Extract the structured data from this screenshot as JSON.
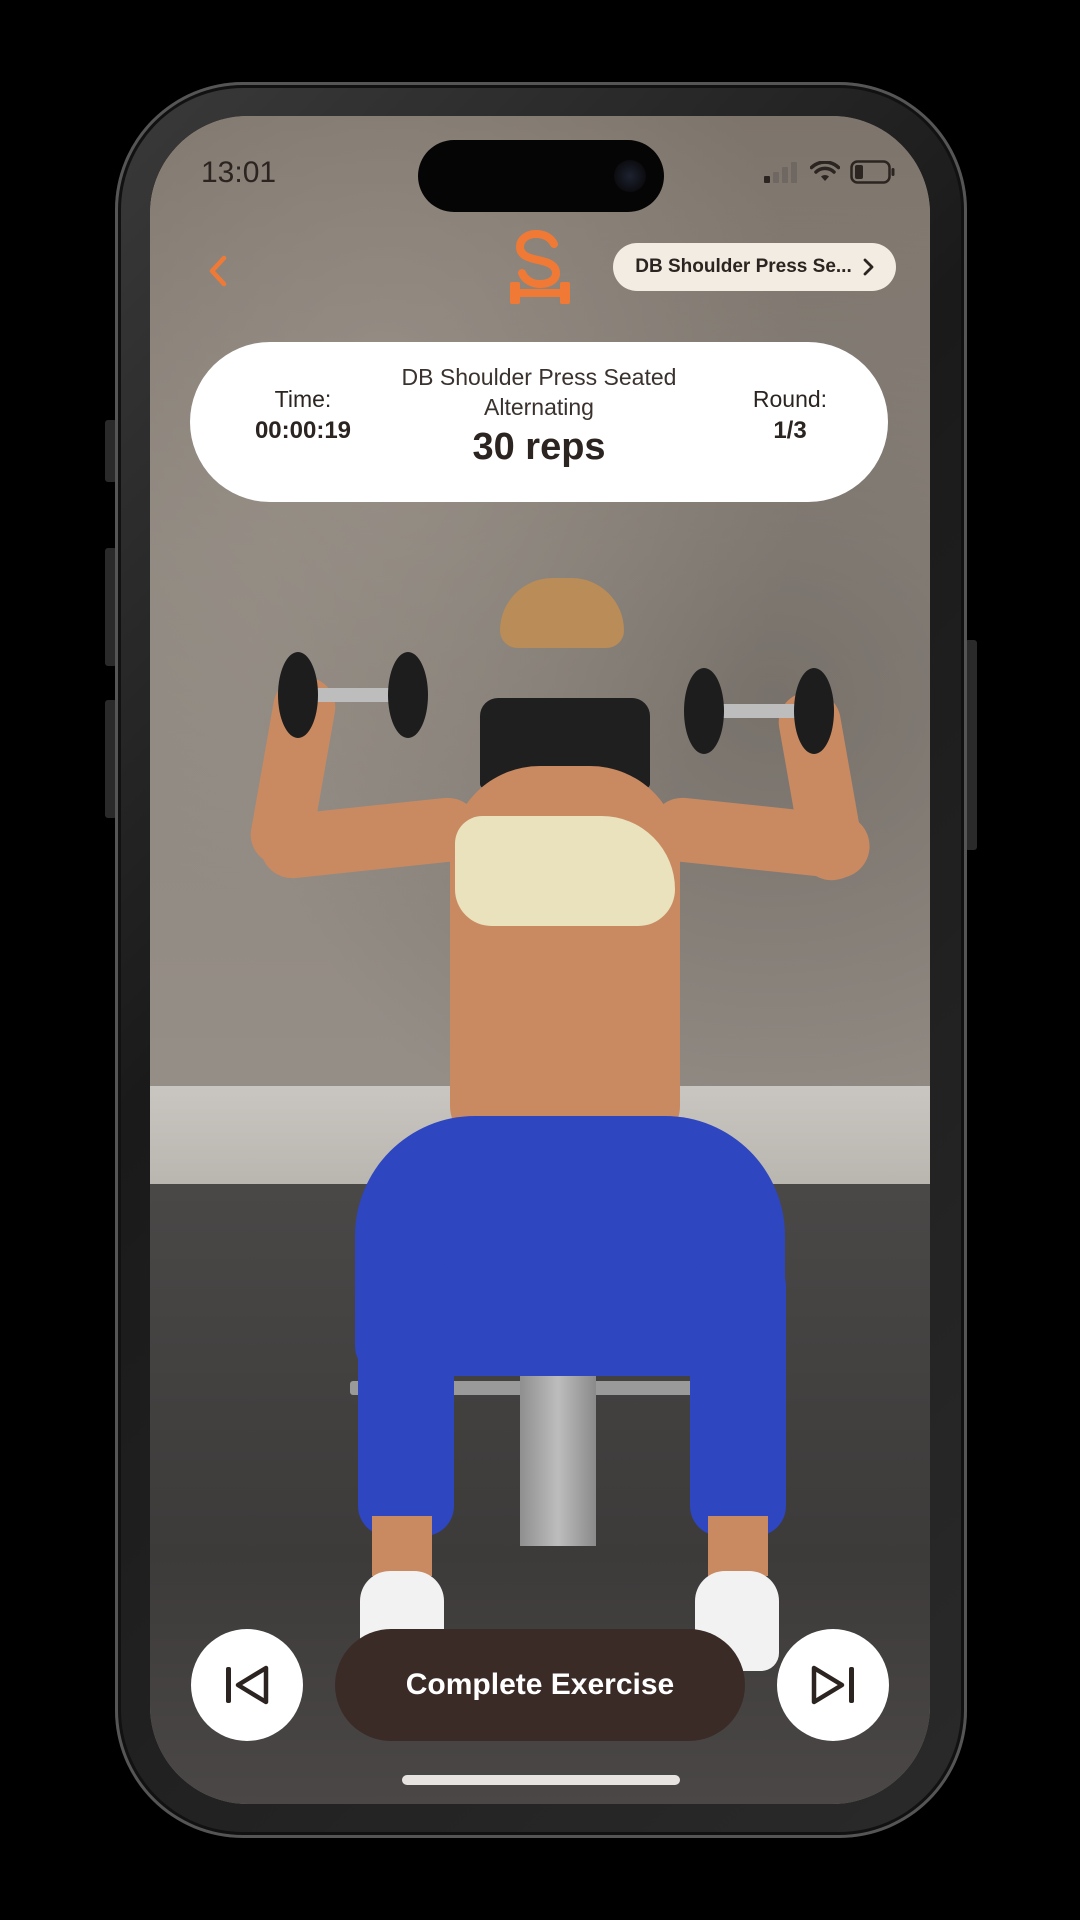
{
  "status_bar": {
    "time": "13:01",
    "icons": [
      "signal-icon",
      "wifi-icon",
      "battery-icon"
    ]
  },
  "nav": {
    "back_icon": "chevron-left-icon",
    "brand_logo_icon": "s-dumbbell-logo-icon",
    "exercise_pill_label": "DB Shoulder Press Se...",
    "exercise_pill_icon": "chevron-right-icon"
  },
  "workout": {
    "time_label": "Time:",
    "time_value": "00:00:19",
    "exercise_name_line1": "DB Shoulder Press Seated",
    "exercise_name_line2": "Alternating",
    "reps": "30 reps",
    "round_label": "Round:",
    "round_value": "1/3"
  },
  "controls": {
    "previous_icon": "skip-previous-icon",
    "complete_label": "Complete Exercise",
    "next_icon": "skip-next-icon"
  },
  "colors": {
    "accent": "#f07a35",
    "card": "#ffffff",
    "pill": "#f2ece2",
    "button_dark": "#3a2b27",
    "text_dark": "#2b2420"
  }
}
